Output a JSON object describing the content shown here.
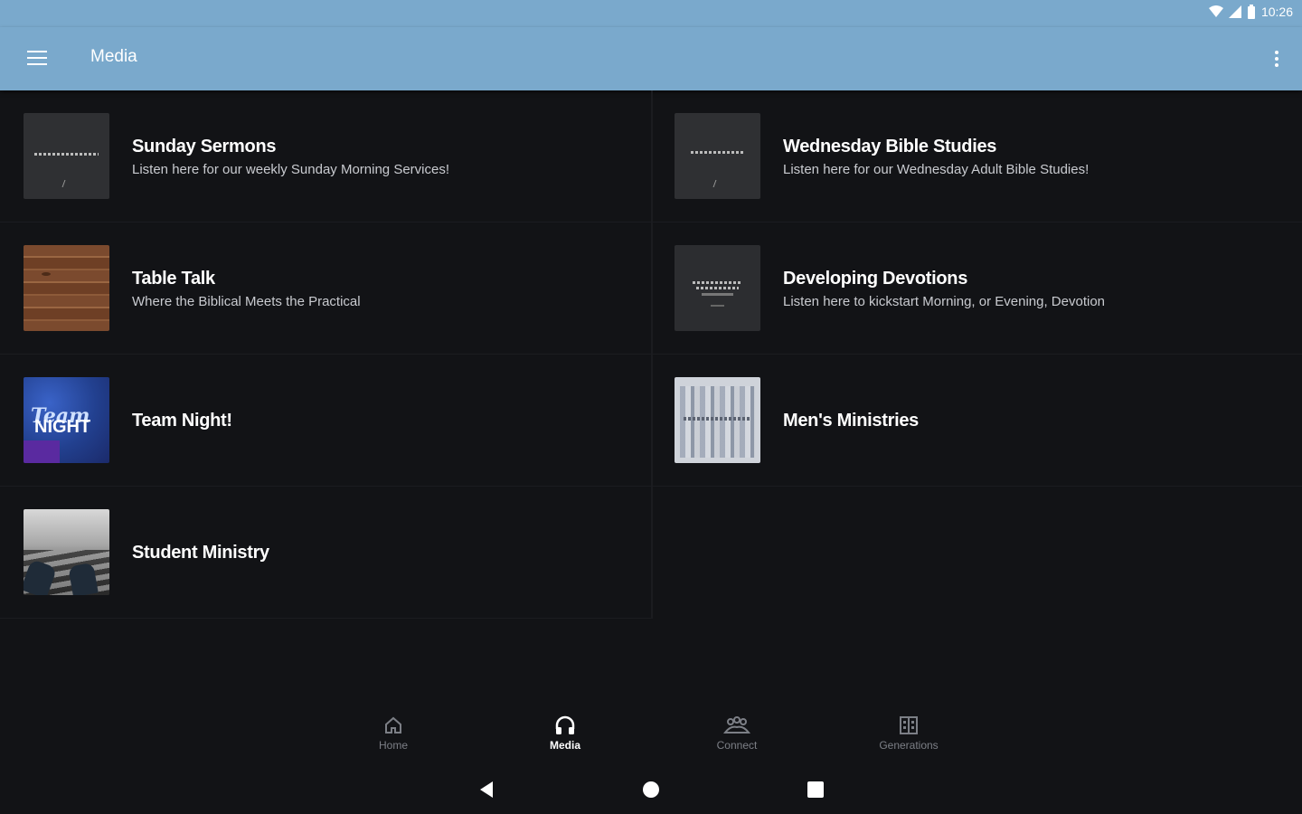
{
  "status": {
    "time": "10:26"
  },
  "appbar": {
    "title": "Media"
  },
  "items": [
    {
      "title": "Sunday Sermons",
      "subtitle": "Listen here for our weekly Sunday Morning Services!",
      "thumbnail": "dark-logo"
    },
    {
      "title": "Wednesday Bible Studies",
      "subtitle": "Listen here for our Wednesday Adult Bible Studies!",
      "thumbnail": "dark-logo"
    },
    {
      "title": "Table Talk",
      "subtitle": "Where the Biblical Meets the Practical",
      "thumbnail": "wood"
    },
    {
      "title": "Developing Devotions",
      "subtitle": "Listen here to kickstart Morning, or Evening, Devotion",
      "thumbnail": "dark-logo"
    },
    {
      "title": "Team Night!",
      "subtitle": "",
      "thumbnail": "team-night"
    },
    {
      "title": "Men's Ministries",
      "subtitle": "",
      "thumbnail": "mens-ministries"
    },
    {
      "title": "Student Ministry",
      "subtitle": "",
      "thumbnail": "student-ministry"
    }
  ],
  "bottom_nav": [
    {
      "label": "Home",
      "icon": "home-icon",
      "active": false
    },
    {
      "label": "Media",
      "icon": "headphones-icon",
      "active": true
    },
    {
      "label": "Connect",
      "icon": "people-icon",
      "active": false
    },
    {
      "label": "Generations",
      "icon": "building-icon",
      "active": false
    }
  ],
  "colors": {
    "appbar": "#7aa9cc",
    "background": "#121316",
    "inactive_nav": "#7c7f86"
  }
}
